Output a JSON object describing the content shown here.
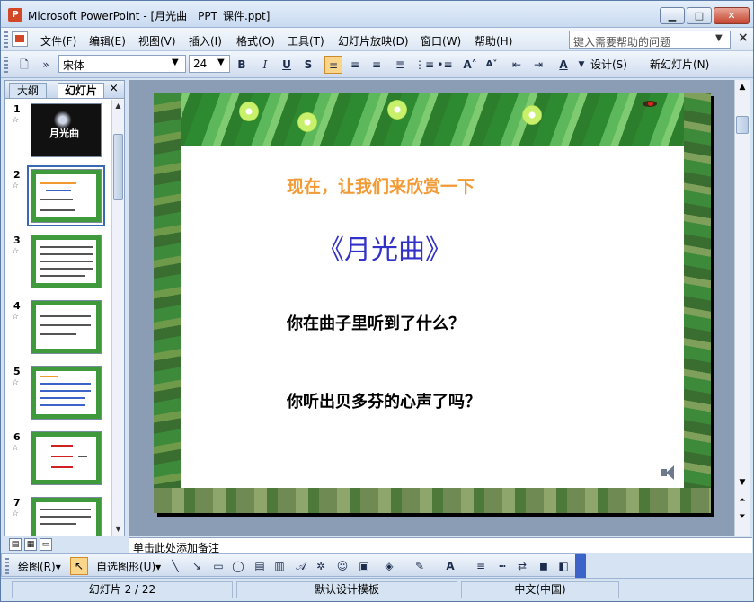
{
  "window": {
    "title": "Microsoft PowerPoint - [月光曲__PPT_课件.ppt]",
    "app_icon_letter": "P",
    "minimize": "▁",
    "maximize": "□",
    "close": "✕"
  },
  "menu": {
    "items": [
      "文件(F)",
      "编辑(E)",
      "视图(V)",
      "插入(I)",
      "格式(O)",
      "工具(T)",
      "幻灯片放映(D)",
      "窗口(W)",
      "帮助(H)"
    ],
    "help_placeholder": "键入需要帮助的问题",
    "help_arrow": "▼",
    "close": "×"
  },
  "toolbar": {
    "font": "宋体",
    "font_size": "24",
    "dropdown_arrow": "▼",
    "bold": "B",
    "italic": "I",
    "underline": "U",
    "shadow": "S",
    "design": "设计(S)",
    "new_slide": "新幻灯片(N)"
  },
  "left_pane": {
    "tab_outline": "大纲",
    "tab_slides": "幻灯片",
    "close": "×",
    "thumb1_caption": "月光曲",
    "slide_numbers": [
      "1",
      "2",
      "3",
      "4",
      "5",
      "6",
      "7"
    ],
    "star": "☆",
    "selected": 2
  },
  "slide": {
    "intro": "现在，让我们来欣赏一下",
    "title": "《月光曲》",
    "question1": "你在曲子里听到了什么？",
    "question2": "你听出贝多芬的心声了吗？",
    "decor_icons": [
      "speaker-icon",
      "bug-icon"
    ]
  },
  "notes": {
    "placeholder": "单击此处添加备注"
  },
  "draw_toolbar": {
    "draw": "绘图(R)▾",
    "autoshapes": "自选图形(U)▾"
  },
  "status": {
    "slide": "幻灯片 2 / 22",
    "template": "默认设计模板",
    "language": "中文(中国)"
  },
  "colors": {
    "intro_text": "#f29a35",
    "title_text": "#3232c8",
    "accent": "#3c64c8"
  }
}
